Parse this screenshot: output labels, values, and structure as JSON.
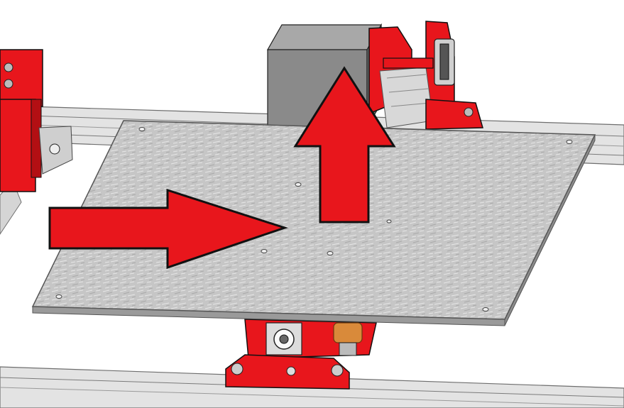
{
  "scene": {
    "colors": {
      "background": "#ffffff",
      "part_red": "#e8161c",
      "part_red_dark": "#a80c10",
      "rail": "#dcdcdc",
      "rail_edge": "#6e6e6e",
      "plate": "#c4c4c4",
      "plate_edge": "#8c8c8c",
      "motor": "#8a8a8a",
      "arrow_fill": "#e8161c",
      "arrow_stroke": "#111111",
      "brass": "#d98a3a"
    },
    "arrows": [
      {
        "direction": "right"
      },
      {
        "direction": "up"
      }
    ]
  }
}
